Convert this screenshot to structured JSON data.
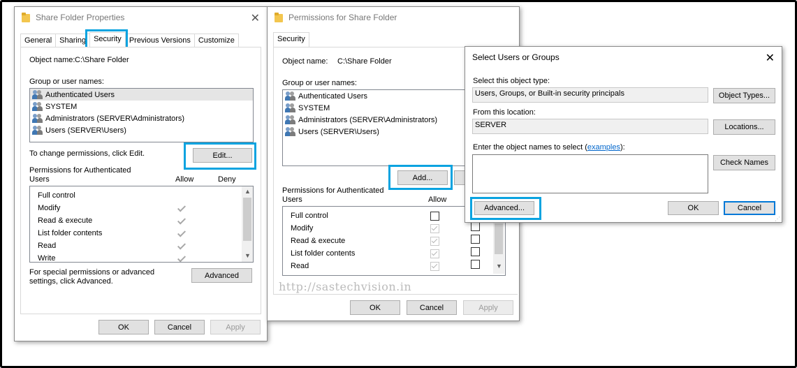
{
  "colors": {
    "highlight": "#0aa3e0",
    "default_button": "#0078d7",
    "link": "#0066cc"
  },
  "properties_window": {
    "title": "Share Folder Properties",
    "tabs": [
      "General",
      "Sharing",
      "Security",
      "Previous Versions",
      "Customize"
    ],
    "active_tab": "Security",
    "object_name_label": "Object name:",
    "object_name_value": "C:\\Share Folder",
    "group_label": "Group or user names:",
    "users": [
      "Authenticated Users",
      "SYSTEM",
      "Administrators (SERVER\\Administrators)",
      "Users (SERVER\\Users)"
    ],
    "change_text": "To change permissions, click Edit.",
    "edit_button": "Edit...",
    "permissions_label": "Permissions for Authenticated Users",
    "allow_header": "Allow",
    "deny_header": "Deny",
    "permissions": [
      {
        "name": "Full control",
        "allow": false
      },
      {
        "name": "Modify",
        "allow": true
      },
      {
        "name": "Read & execute",
        "allow": true
      },
      {
        "name": "List folder contents",
        "allow": true
      },
      {
        "name": "Read",
        "allow": true
      },
      {
        "name": "Write",
        "allow": true
      }
    ],
    "special_text": "For special permissions or advanced settings, click Advanced.",
    "advanced_button": "Advanced",
    "ok": "OK",
    "cancel": "Cancel",
    "apply": "Apply"
  },
  "permissions_window": {
    "title": "Permissions for Share Folder",
    "tab": "Security",
    "object_name_label": "Object name:",
    "object_name_value": "C:\\Share Folder",
    "group_label": "Group or user names:",
    "users": [
      "Authenticated Users",
      "SYSTEM",
      "Administrators (SERVER\\Administrators)",
      "Users (SERVER\\Users)"
    ],
    "add_button": "Add...",
    "permissions_label": "Permissions for Authenticated Users",
    "allow_header": "Allow",
    "permissions": [
      {
        "name": "Full control",
        "allow": false,
        "allow_disabled": false
      },
      {
        "name": "Modify",
        "allow": true,
        "allow_disabled": true
      },
      {
        "name": "Read & execute",
        "allow": true,
        "allow_disabled": true
      },
      {
        "name": "List folder contents",
        "allow": true,
        "allow_disabled": true
      },
      {
        "name": "Read",
        "allow": true,
        "allow_disabled": true
      }
    ],
    "ok": "OK",
    "cancel": "Cancel",
    "apply": "Apply"
  },
  "select_dialog": {
    "title": "Select Users or Groups",
    "object_type_label": "Select this object type:",
    "object_type_value": "Users, Groups, or Built-in security principals",
    "object_types_button": "Object Types...",
    "location_label": "From this location:",
    "location_value": "SERVER",
    "locations_button": "Locations...",
    "enter_label": "Enter the object names to select (",
    "examples_link": "examples",
    "enter_label_end": "):",
    "check_names_button": "Check Names",
    "advanced_button": "Advanced...",
    "ok": "OK",
    "cancel": "Cancel"
  },
  "watermark": "http://sastechvision.in"
}
